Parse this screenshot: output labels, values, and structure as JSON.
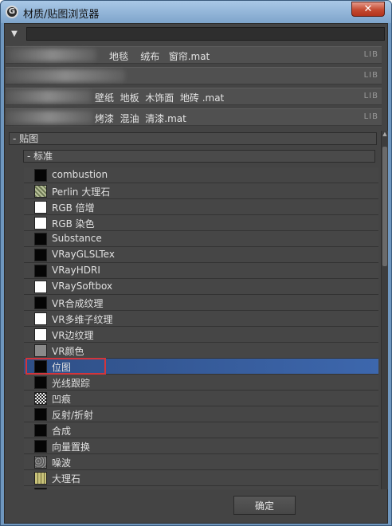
{
  "window": {
    "title": "材质/贴图浏览器",
    "close_glyph": "✕",
    "app_icon_glyph": "G"
  },
  "search": {
    "value": "",
    "placeholder": "",
    "arrow_glyph": "▼"
  },
  "libraries": [
    {
      "name": "地毯    绒布   窗帘.mat",
      "tag": "LIB"
    },
    {
      "name": "",
      "tag": "LIB"
    },
    {
      "name": "壁纸  地板  木饰面  地砖 .mat",
      "tag": "LIB"
    },
    {
      "name": "烤漆  混油  清漆.mat",
      "tag": "LIB"
    }
  ],
  "groups": {
    "maps": "- 贴图",
    "standard": "- 标准"
  },
  "maps": [
    {
      "label": "combustion",
      "swatch": "black"
    },
    {
      "label": "Perlin 大理石",
      "swatch": "marble-green"
    },
    {
      "label": "RGB 倍增",
      "swatch": "white"
    },
    {
      "label": "RGB 染色",
      "swatch": "white"
    },
    {
      "label": "Substance",
      "swatch": "black"
    },
    {
      "label": "VRayGLSLTex",
      "swatch": "black"
    },
    {
      "label": "VRayHDRI",
      "swatch": "black"
    },
    {
      "label": "VRaySoftbox",
      "swatch": "white"
    },
    {
      "label": "VR合成纹理",
      "swatch": "black"
    },
    {
      "label": "VR多维子纹理",
      "swatch": "white"
    },
    {
      "label": "VR边纹理",
      "swatch": "white"
    },
    {
      "label": "VR颜色",
      "swatch": "gray"
    },
    {
      "label": "位图",
      "swatch": "black",
      "selected": true
    },
    {
      "label": "光线跟踪",
      "swatch": "black"
    },
    {
      "label": "凹痕",
      "swatch": "checker"
    },
    {
      "label": "反射/折射",
      "swatch": "black"
    },
    {
      "label": "合成",
      "swatch": "black"
    },
    {
      "label": "向量置换",
      "swatch": "black"
    },
    {
      "label": "噪波",
      "swatch": "noise"
    },
    {
      "label": "大理石",
      "swatch": "marble-yellow"
    },
    {
      "label": "",
      "swatch": "black"
    }
  ],
  "footer": {
    "ok_label": "确定"
  },
  "colors": {
    "panel_bg": "#464646",
    "selection": "#3d67ad",
    "highlight_box": "#d3353b"
  }
}
